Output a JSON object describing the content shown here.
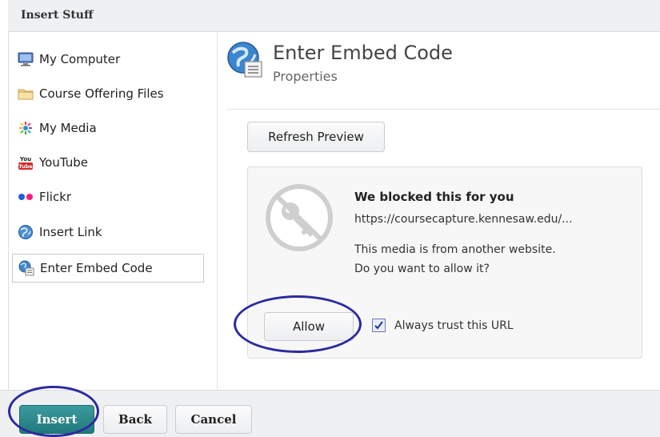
{
  "dialog": {
    "title": "Insert Stuff"
  },
  "sidebar": {
    "items": [
      {
        "label": "My Computer",
        "icon": "computer-icon"
      },
      {
        "label": "Course Offering Files",
        "icon": "folder-icon"
      },
      {
        "label": "My Media",
        "icon": "media-icon"
      },
      {
        "label": "YouTube",
        "icon": "youtube-icon"
      },
      {
        "label": "Flickr",
        "icon": "flickr-icon"
      },
      {
        "label": "Insert Link",
        "icon": "globe-icon"
      },
      {
        "label": "Enter Embed Code",
        "icon": "embed-icon",
        "selected": true
      }
    ]
  },
  "main": {
    "heading": "Enter Embed Code",
    "subheading": "Properties",
    "refresh_label": "Refresh Preview"
  },
  "blocked": {
    "title": "We blocked this for you",
    "url": "https://coursecapture.kennesaw.edu/...",
    "message_line1": "This media is from another website.",
    "message_line2": "Do you want to allow it?",
    "allow_label": "Allow",
    "trust_label": "Always trust this URL",
    "trust_checked": true
  },
  "footer": {
    "insert_label": "Insert",
    "back_label": "Back",
    "cancel_label": "Cancel"
  },
  "colors": {
    "accent_teal": "#21797c",
    "highlight_ring": "#2c2a9e"
  }
}
